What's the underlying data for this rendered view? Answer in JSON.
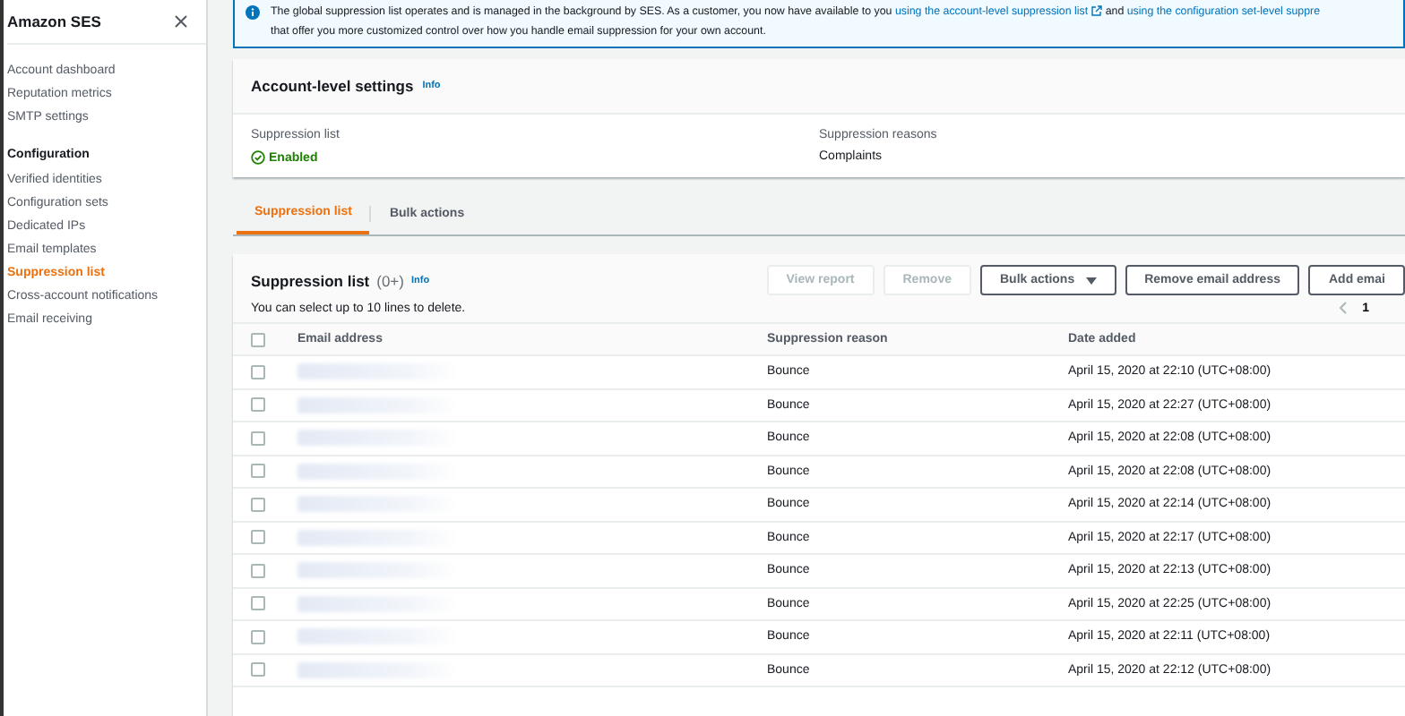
{
  "sidebar": {
    "title": "Amazon SES",
    "sections": [
      {
        "items": [
          {
            "label": "Account dashboard",
            "selected": false
          },
          {
            "label": "Reputation metrics",
            "selected": false
          },
          {
            "label": "SMTP settings",
            "selected": false
          }
        ]
      },
      {
        "heading": "Configuration",
        "items": [
          {
            "label": "Verified identities",
            "selected": false
          },
          {
            "label": "Configuration sets",
            "selected": false
          },
          {
            "label": "Dedicated IPs",
            "selected": false
          },
          {
            "label": "Email templates",
            "selected": false
          },
          {
            "label": "Suppression list",
            "selected": true
          },
          {
            "label": "Cross-account notifications",
            "selected": false
          },
          {
            "label": "Email receiving",
            "selected": false
          }
        ]
      }
    ]
  },
  "banner": {
    "lines": [
      [
        {
          "kind": "text",
          "text": "The global suppression list operates and is managed in the background by SES. As a customer, you now have available to you "
        },
        {
          "kind": "link",
          "text": "using the account-level suppression list",
          "external": true
        },
        {
          "kind": "text",
          "text": " and "
        },
        {
          "kind": "link",
          "text": "using the configuration set-level suppre",
          "external": false
        }
      ],
      [
        {
          "kind": "text",
          "text": "that offer you more customized control over how you handle email suppression for your own account."
        }
      ]
    ]
  },
  "account_settings": {
    "title": "Account-level settings",
    "info": "Info",
    "fields": [
      {
        "label": "Suppression list",
        "value": "Enabled",
        "kind": "status"
      },
      {
        "label": "Suppression reasons",
        "value": "Complaints",
        "kind": "plain"
      }
    ]
  },
  "tabs": [
    {
      "label": "Suppression list",
      "selected": true
    },
    {
      "label": "Bulk actions",
      "selected": false
    }
  ],
  "suppression_list": {
    "title": "Suppression list",
    "count": "(0+)",
    "info": "Info",
    "description": "You can select up to 10 lines to delete.",
    "buttons": [
      {
        "label": "View report",
        "disabled": true,
        "dropdown": false
      },
      {
        "label": "Remove",
        "disabled": true,
        "dropdown": false
      },
      {
        "label": "Bulk actions",
        "disabled": false,
        "dropdown": true
      },
      {
        "label": "Remove email address",
        "disabled": false,
        "dropdown": false
      },
      {
        "label": "Add emai",
        "disabled": false,
        "dropdown": false
      }
    ],
    "page": "1",
    "select_all_checked": false,
    "columns": [
      "Email address",
      "Suppression reason",
      "Date added"
    ],
    "rows": [
      {
        "checked": false,
        "reason": "Bounce",
        "date": "April 15, 2020 at 22:10 (UTC+08:00)"
      },
      {
        "checked": false,
        "reason": "Bounce",
        "date": "April 15, 2020 at 22:27 (UTC+08:00)"
      },
      {
        "checked": false,
        "reason": "Bounce",
        "date": "April 15, 2020 at 22:08 (UTC+08:00)"
      },
      {
        "checked": false,
        "reason": "Bounce",
        "date": "April 15, 2020 at 22:08 (UTC+08:00)"
      },
      {
        "checked": false,
        "reason": "Bounce",
        "date": "April 15, 2020 at 22:14 (UTC+08:00)"
      },
      {
        "checked": false,
        "reason": "Bounce",
        "date": "April 15, 2020 at 22:17 (UTC+08:00)"
      },
      {
        "checked": false,
        "reason": "Bounce",
        "date": "April 15, 2020 at 22:13 (UTC+08:00)"
      },
      {
        "checked": false,
        "reason": "Bounce",
        "date": "April 15, 2020 at 22:25 (UTC+08:00)"
      },
      {
        "checked": false,
        "reason": "Bounce",
        "date": "April 15, 2020 at 22:11 (UTC+08:00)"
      },
      {
        "checked": false,
        "reason": "Bounce",
        "date": "April 15, 2020 at 22:12 (UTC+08:00)"
      }
    ]
  }
}
